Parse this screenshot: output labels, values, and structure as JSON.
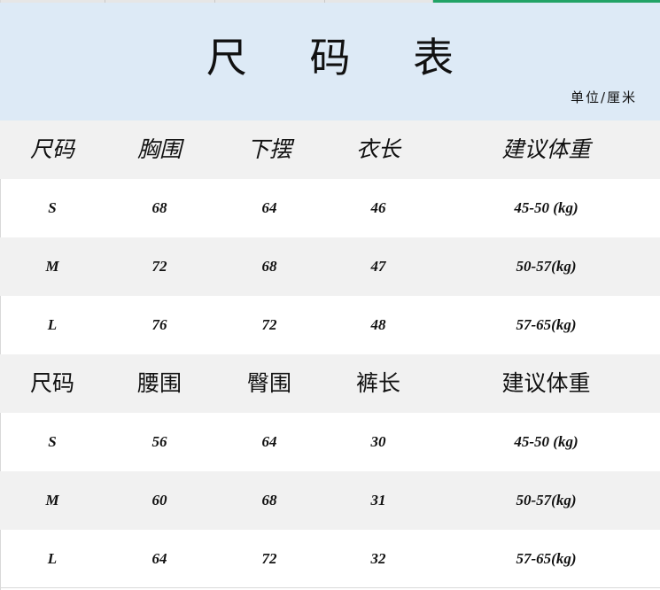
{
  "title": "尺 码 表",
  "unit": "单位/厘米",
  "top_section": {
    "headers": [
      "尺码",
      "胸围",
      "下摆",
      "衣长",
      "建议体重"
    ],
    "rows": [
      [
        "S",
        "68",
        "64",
        "46",
        "45-50 (kg)"
      ],
      [
        "M",
        "72",
        "68",
        "47",
        "50-57(kg)"
      ],
      [
        "L",
        "76",
        "72",
        "48",
        "57-65(kg)"
      ]
    ]
  },
  "bottom_section": {
    "headers": [
      "尺码",
      "腰围",
      "臀围",
      "裤长",
      "建议体重"
    ],
    "rows": [
      [
        "S",
        "56",
        "64",
        "30",
        "45-50 (kg)"
      ],
      [
        "M",
        "60",
        "68",
        "31",
        "50-57(kg)"
      ],
      [
        "L",
        "64",
        "72",
        "32",
        "57-65(kg)"
      ]
    ]
  },
  "colors": {
    "header_bg": "#ddeaf6",
    "row_shade": "#f1f1f1",
    "accent": "#21a366"
  }
}
